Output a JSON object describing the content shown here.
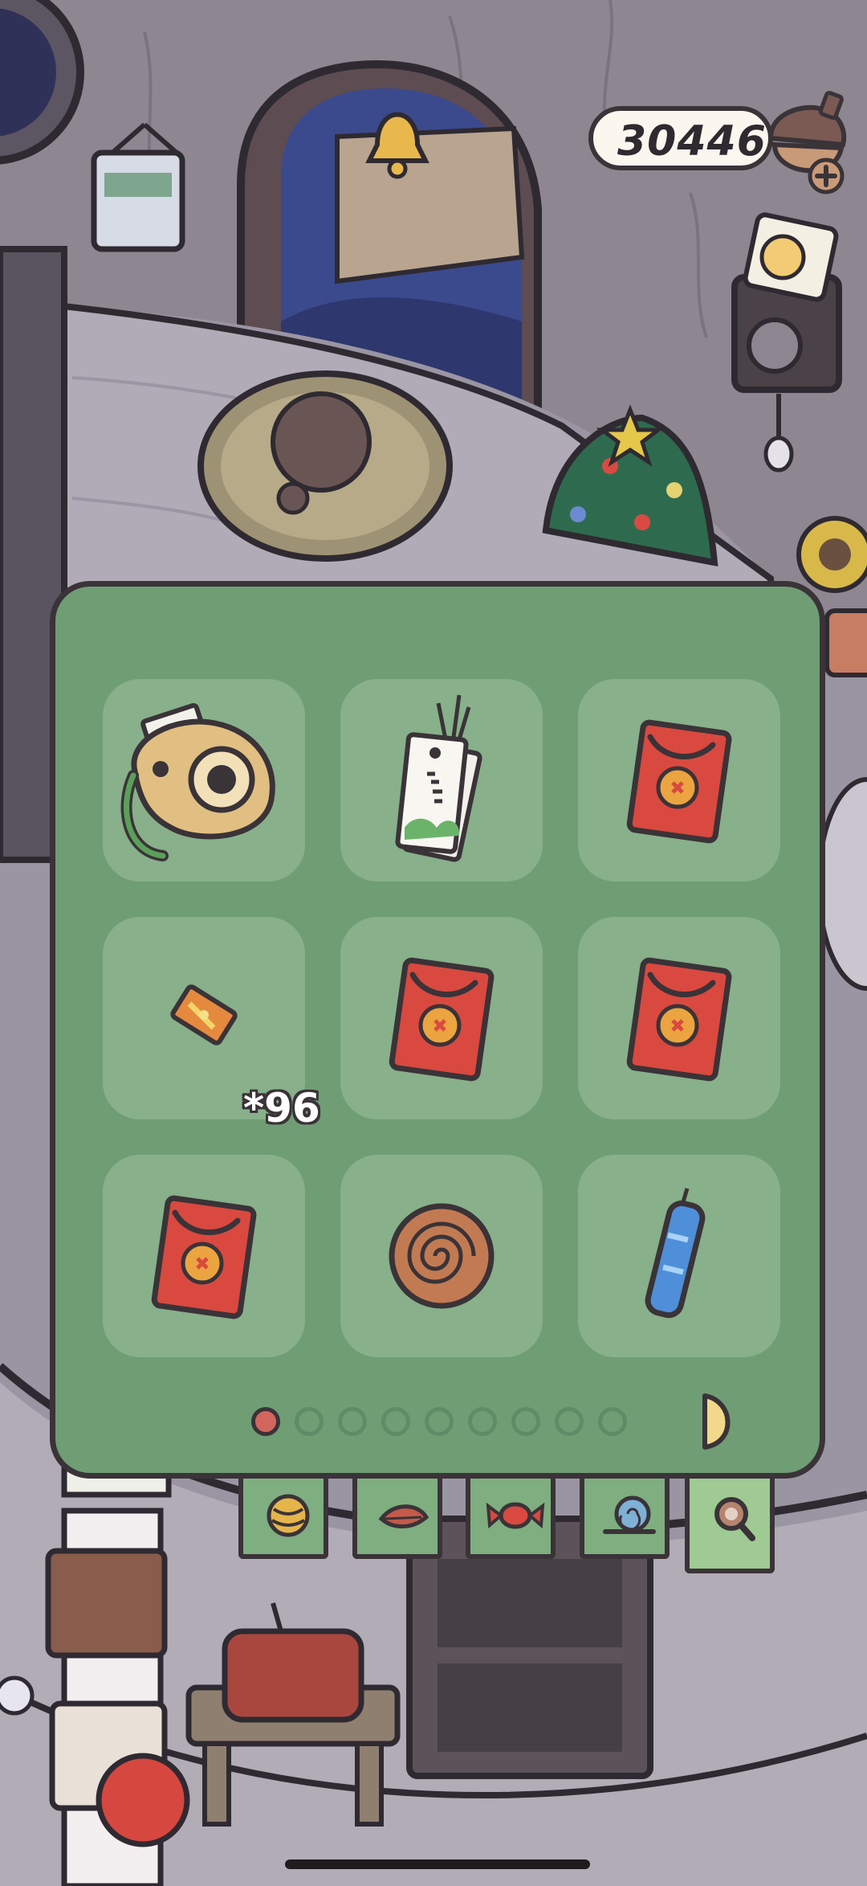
{
  "hud": {
    "currency_value": "30446",
    "currency_icon": "acorn-icon",
    "add_icon": "plus-icon"
  },
  "inventory": {
    "items": [
      {
        "icon": "instant-camera-icon",
        "count": ""
      },
      {
        "icon": "bookmark-tags-icon",
        "count": ""
      },
      {
        "icon": "red-envelope-icon",
        "count": ""
      },
      {
        "icon": "ticket-icon",
        "count": "*96"
      },
      {
        "icon": "red-envelope-icon",
        "count": ""
      },
      {
        "icon": "red-envelope-icon",
        "count": ""
      },
      {
        "icon": "red-envelope-icon",
        "count": ""
      },
      {
        "icon": "swirl-cookie-icon",
        "count": ""
      },
      {
        "icon": "blue-firecracker-icon",
        "count": ""
      }
    ],
    "page_current": 1,
    "page_total": 9
  },
  "tabs": [
    {
      "icon": "yarn-ball-icon",
      "active": false
    },
    {
      "icon": "leaf-icon",
      "active": false
    },
    {
      "icon": "candy-icon",
      "active": false
    },
    {
      "icon": "snail-icon",
      "active": false
    },
    {
      "icon": "magnifier-icon",
      "active": true
    }
  ],
  "colors": {
    "panel": "#6f9d74",
    "slot": "#88b08a",
    "outline": "#3a3338",
    "envelope_red": "#d9493f",
    "active_dot": "#d2665f"
  }
}
